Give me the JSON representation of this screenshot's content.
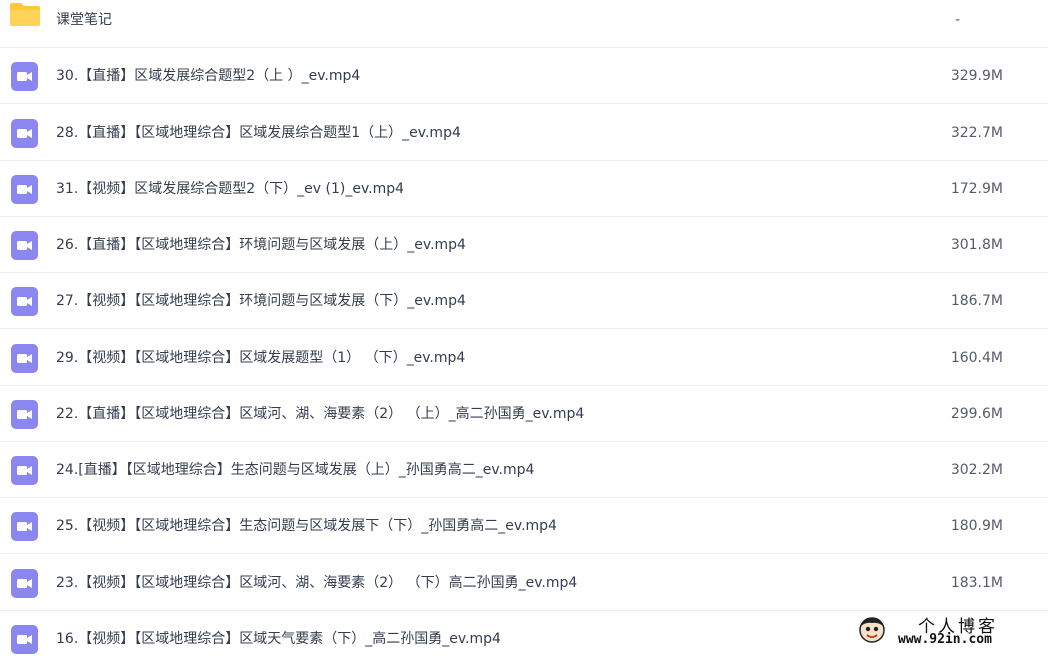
{
  "files": [
    {
      "name": "课堂笔记",
      "size": "-",
      "type": "folder"
    },
    {
      "name": "30.【直播】区域发展综合题型2（上 ）_ev.mp4",
      "size": "329.9M",
      "type": "video"
    },
    {
      "name": "28.【直播】【区域地理综合】区域发展综合题型1（上）_ev.mp4",
      "size": "322.7M",
      "type": "video"
    },
    {
      "name": "31.【视频】区域发展综合题型2（下）_ev (1)_ev.mp4",
      "size": "172.9M",
      "type": "video"
    },
    {
      "name": "26.【直播】【区域地理综合】环境问题与区域发展（上）_ev.mp4",
      "size": "301.8M",
      "type": "video"
    },
    {
      "name": "27.【视频】【区域地理综合】环境问题与区域发展（下）_ev.mp4",
      "size": "186.7M",
      "type": "video"
    },
    {
      "name": "29.【视频】【区域地理综合】区域发展题型（1） （下）_ev.mp4",
      "size": "160.4M",
      "type": "video"
    },
    {
      "name": "22.【直播】【区域地理综合】区域河、湖、海要素（2） （上）_高二孙国勇_ev.mp4",
      "size": "299.6M",
      "type": "video"
    },
    {
      "name": "24.[直播】【区域地理综合】生态问题与区域发展（上）_孙国勇高二_ev.mp4",
      "size": "302.2M",
      "type": "video"
    },
    {
      "name": "25.【视频】【区域地理综合】生态问题与区域发展下（下）_孙国勇高二_ev.mp4",
      "size": "180.9M",
      "type": "video"
    },
    {
      "name": "23.【视频】【区域地理综合】区域河、湖、海要素（2） （下）高二孙国勇_ev.mp4",
      "size": "183.1M",
      "type": "video"
    },
    {
      "name": "16.【视频】【区域地理综合】区域天气要素（下）_高二孙国勇_ev.mp4",
      "size": "",
      "type": "video"
    }
  ],
  "watermark": {
    "title": "个人博客",
    "url": "www.92in.com"
  },
  "colors": {
    "folder": "#ffc93c",
    "video_icon": "#8b86f0",
    "text": "#333d4f",
    "divider": "#eceef2"
  },
  "icons": {
    "folder": "folder-icon",
    "video": "video-file-icon"
  }
}
